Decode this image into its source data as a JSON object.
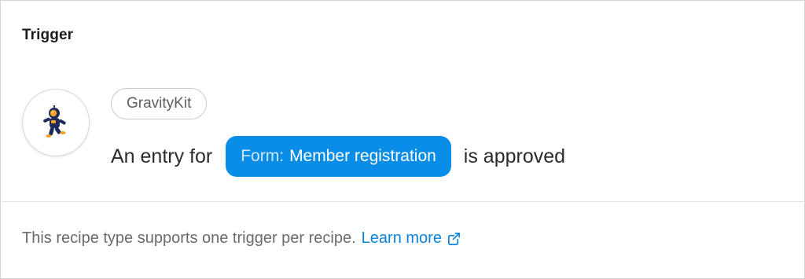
{
  "card": {
    "title": "Trigger"
  },
  "integration": {
    "name": "GravityKit",
    "icon": "astronaut-icon"
  },
  "sentence": {
    "before": "An entry for",
    "token_field": "Form:",
    "token_value": "Member registration",
    "after": "is approved"
  },
  "footer": {
    "text": "This recipe type supports one trigger per recipe.",
    "link_label": "Learn more",
    "link_icon": "external-link-icon"
  },
  "colors": {
    "token_bg": "#0a8de6",
    "link": "#0b84d8"
  }
}
